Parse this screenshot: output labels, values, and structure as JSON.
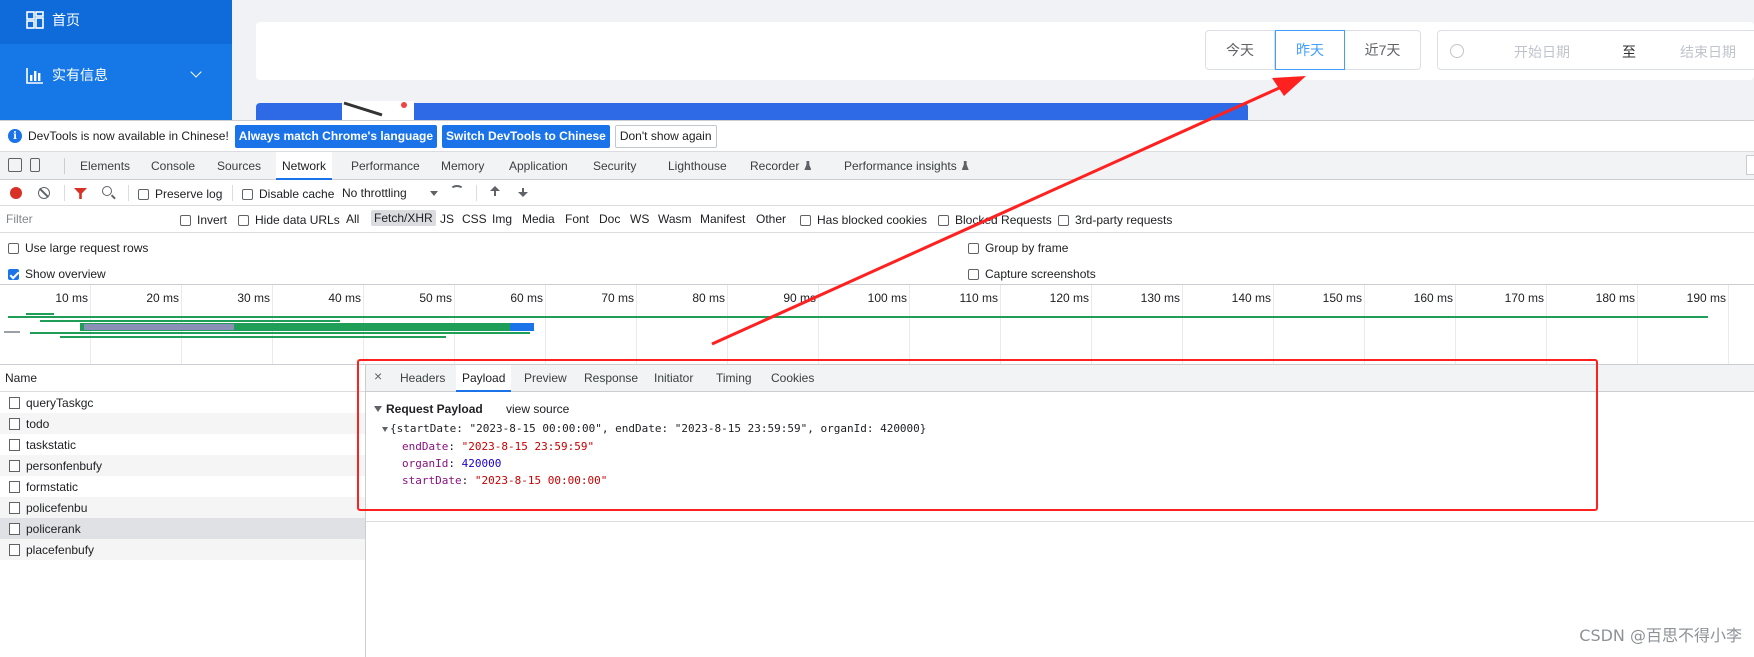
{
  "app": {
    "sidebar": [
      {
        "label": "首页",
        "icon": "home-grid-icon"
      },
      {
        "label": "实有信息",
        "icon": "bar-chart-icon"
      }
    ],
    "date_buttons": [
      "今天",
      "昨天",
      "近7天"
    ],
    "active_date_button": "昨天",
    "date_range": {
      "start_placeholder": "开始日期",
      "separator": "至",
      "end_placeholder": "结束日期"
    }
  },
  "devtools": {
    "infobar": {
      "message": "DevTools is now available in Chinese!",
      "btn_match": "Always match Chrome's language",
      "btn_switch": "Switch DevTools to Chinese",
      "btn_dismiss": "Don't show again"
    },
    "tabs": [
      "Elements",
      "Console",
      "Sources",
      "Network",
      "Performance",
      "Memory",
      "Application",
      "Security",
      "Lighthouse",
      "Recorder",
      "Performance insights"
    ],
    "active_tab": "Network",
    "toolbar": {
      "preserve_log": "Preserve log",
      "disable_cache": "Disable cache",
      "throttling": "No throttling"
    },
    "filter": {
      "placeholder": "Filter",
      "invert": "Invert",
      "hide_data_urls": "Hide data URLs",
      "types": [
        "All",
        "Fetch/XHR",
        "JS",
        "CSS",
        "Img",
        "Media",
        "Font",
        "Doc",
        "WS",
        "Wasm",
        "Manifest",
        "Other"
      ],
      "active_type": "Fetch/XHR",
      "has_blocked_cookies": "Has blocked cookies",
      "blocked_requests": "Blocked Requests",
      "third_party": "3rd-party requests"
    },
    "settings": {
      "large_rows": "Use large request rows",
      "show_overview": "Show overview",
      "group_by_frame": "Group by frame",
      "capture_screenshots": "Capture screenshots"
    },
    "timeline_ticks": [
      "10 ms",
      "20 ms",
      "30 ms",
      "40 ms",
      "50 ms",
      "60 ms",
      "70 ms",
      "80 ms",
      "90 ms",
      "100 ms",
      "110 ms",
      "120 ms",
      "130 ms",
      "140 ms",
      "150 ms",
      "160 ms",
      "170 ms",
      "180 ms",
      "190 ms"
    ],
    "requests": {
      "header": "Name",
      "items": [
        "queryTaskgc",
        "todo",
        "taskstatic",
        "personfenbufy",
        "formstatic",
        "policefenbu",
        "policerank",
        "placefenbufy"
      ],
      "selected": "policerank"
    },
    "detail": {
      "tabs": [
        "Headers",
        "Payload",
        "Preview",
        "Response",
        "Initiator",
        "Timing",
        "Cookies"
      ],
      "active_tab": "Payload",
      "payload": {
        "section_title": "Request Payload",
        "view_source": "view source",
        "summary": "{startDate: \"2023-8-15 00:00:00\", endDate: \"2023-8-15 23:59:59\", organId: 420000}",
        "fields": [
          {
            "key": "endDate",
            "value": "\"2023-8-15 23:59:59\"",
            "kind": "string"
          },
          {
            "key": "organId",
            "value": "420000",
            "kind": "number"
          },
          {
            "key": "startDate",
            "value": "\"2023-8-15 00:00:00\"",
            "kind": "string"
          }
        ]
      }
    }
  },
  "watermark": "CSDN @百思不得小李",
  "colors": {
    "annotation": "#ff2020",
    "accent": "#1a73e8",
    "sidebar": "#1677e6"
  }
}
